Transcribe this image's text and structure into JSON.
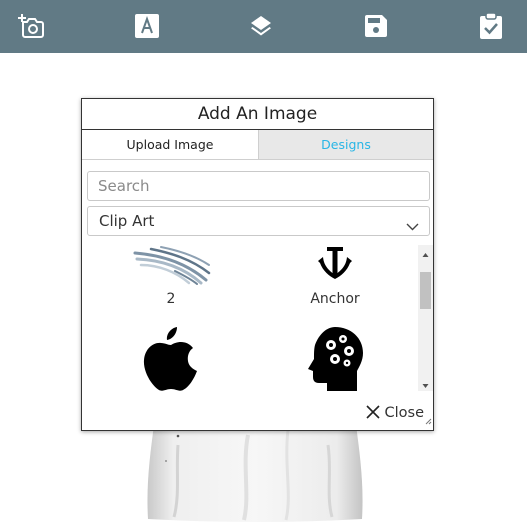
{
  "toolbar": {
    "tools": [
      {
        "name": "add-photo",
        "icon": "camera-plus-icon"
      },
      {
        "name": "add-text",
        "icon": "text-a-icon"
      },
      {
        "name": "layers",
        "icon": "layers-icon"
      },
      {
        "name": "save",
        "icon": "floppy-disk-icon"
      },
      {
        "name": "checkout",
        "icon": "clipboard-check-icon"
      }
    ],
    "background": "#617a85"
  },
  "dialog": {
    "title": "Add An Image",
    "tabs": {
      "upload_label": "Upload Image",
      "designs_label": "Designs"
    },
    "active_tab": "Designs",
    "search": {
      "placeholder": "Search",
      "value": ""
    },
    "category": {
      "selected": "Clip Art"
    },
    "items": [
      {
        "label": "2",
        "icon": "feathers-wing-icon"
      },
      {
        "label": "Anchor",
        "icon": "anchor-icon"
      },
      {
        "label": "",
        "icon": "apple-logo-icon"
      },
      {
        "label": "",
        "icon": "head-gears-icon"
      }
    ],
    "close_label": "Close"
  },
  "colors": {
    "accent": "#29b6e6",
    "toolbar": "#617a85",
    "tab_inactive_bg": "#e8e8e8"
  }
}
